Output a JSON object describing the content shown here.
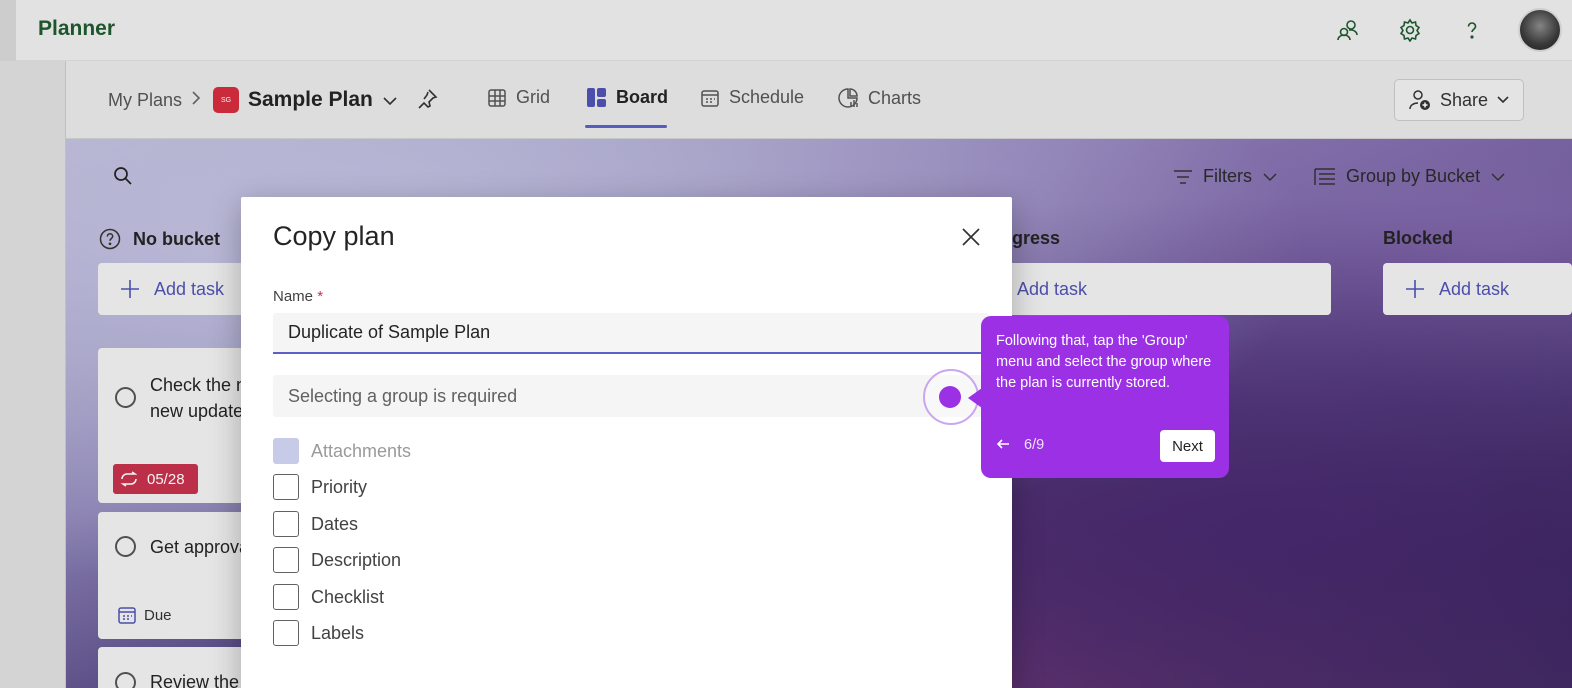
{
  "app": {
    "title": "Planner"
  },
  "breadcrumb": {
    "root": "My Plans",
    "plan_badge": "SG",
    "plan_name": "Sample Plan"
  },
  "tabs": [
    {
      "label": "Grid",
      "icon": "grid-icon",
      "active": false
    },
    {
      "label": "Board",
      "icon": "board-icon",
      "active": true
    },
    {
      "label": "Schedule",
      "icon": "calendar-icon",
      "active": false
    },
    {
      "label": "Charts",
      "icon": "chart-icon",
      "active": false
    }
  ],
  "share": {
    "label": "Share"
  },
  "toolbar": {
    "filters_label": "Filters",
    "group_by_label": "Group by Bucket"
  },
  "buckets": [
    {
      "name": "No bucket",
      "add_task": "Add task"
    },
    {
      "name": "gress",
      "add_task": "Add task"
    },
    {
      "name": "Blocked",
      "add_task": "Add task"
    }
  ],
  "cards": [
    {
      "title_line1": "Check the n",
      "title_line2": "new update",
      "badge": "05/28"
    },
    {
      "title_line1": "Get approva",
      "due": "Due"
    },
    {
      "title_line1": "Review the"
    }
  ],
  "dialog": {
    "title": "Copy plan",
    "name_label": "Name",
    "required_mark": "*",
    "name_value": "Duplicate of Sample Plan",
    "group_placeholder": "Selecting a group is required",
    "options": [
      {
        "label": "Attachments",
        "disabled": true
      },
      {
        "label": "Priority",
        "disabled": false
      },
      {
        "label": "Dates",
        "disabled": false
      },
      {
        "label": "Description",
        "disabled": false
      },
      {
        "label": "Checklist",
        "disabled": false
      },
      {
        "label": "Labels",
        "disabled": false
      }
    ]
  },
  "tour": {
    "message": "Following that, tap the 'Group' menu and select the group where the plan is currently stored.",
    "step": "6/9",
    "next_label": "Next",
    "accent": "#9b30e5"
  }
}
